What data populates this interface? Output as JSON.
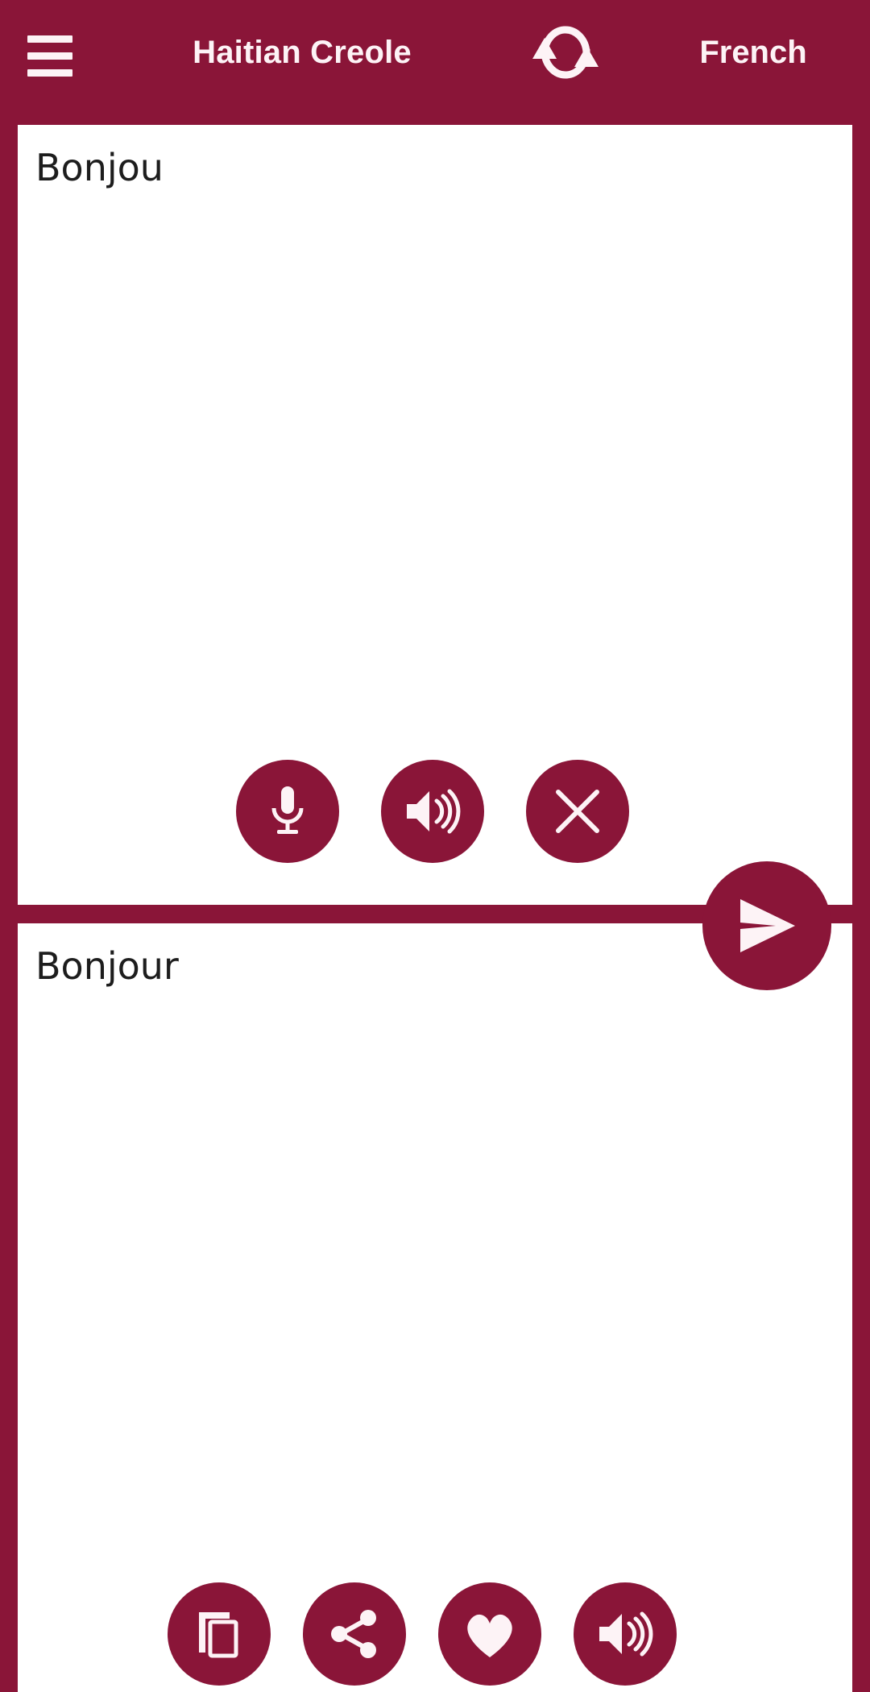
{
  "app": {
    "accent_color": "#8A1538",
    "panel_background": "#FFFFFF",
    "text_color": "#1D1D1D",
    "icon_color": "#FDF3F6"
  },
  "header": {
    "menu_icon": "hamburger-menu-icon",
    "source_language": "Haitian Creole",
    "swap_icon": "swap-languages-icon",
    "target_language": "French"
  },
  "source_panel": {
    "text": "Bonjou",
    "placeholder": "",
    "actions": [
      {
        "name": "microphone",
        "icon": "microphone-icon",
        "label": "Speak"
      },
      {
        "name": "listen",
        "icon": "speaker-icon",
        "label": "Listen"
      },
      {
        "name": "clear",
        "icon": "close-icon",
        "label": "Clear"
      }
    ]
  },
  "send": {
    "icon": "send-icon",
    "label": "Translate"
  },
  "target_panel": {
    "text": "Bonjour",
    "actions": [
      {
        "name": "copy",
        "icon": "copy-icon",
        "label": "Copy"
      },
      {
        "name": "share",
        "icon": "share-icon",
        "label": "Share"
      },
      {
        "name": "favorite",
        "icon": "heart-icon",
        "label": "Favorite"
      },
      {
        "name": "speak",
        "icon": "speaker-icon",
        "label": "Speak"
      }
    ]
  }
}
